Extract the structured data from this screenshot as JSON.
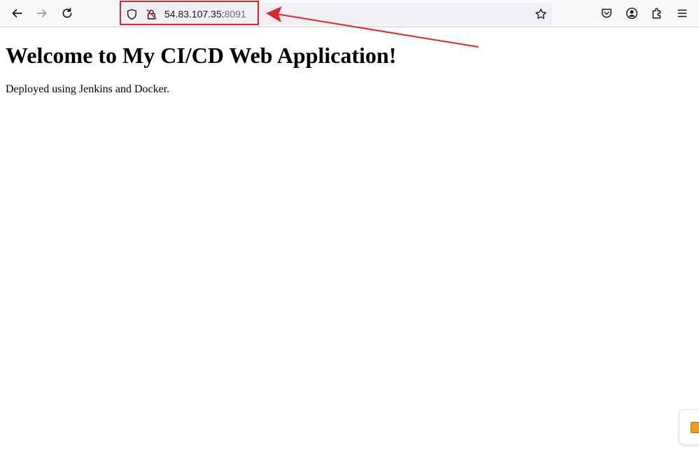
{
  "browser": {
    "url_host": "54.83.107.35:",
    "url_port": "8091",
    "icons": {
      "back": "back-arrow-icon",
      "forward": "forward-arrow-icon",
      "reload": "reload-icon",
      "shield": "tracking-protection-shield-icon",
      "insecure_lock": "insecure-lock-icon",
      "bookmark": "bookmark-star-icon",
      "pocket": "pocket-icon",
      "account": "account-icon",
      "extensions": "extensions-icon",
      "menu": "hamburger-menu-icon"
    }
  },
  "annotation": {
    "color": "#e0262b"
  },
  "page": {
    "heading": "Welcome to My CI/CD Web Application!",
    "paragraph": "Deployed using Jenkins and Docker."
  }
}
